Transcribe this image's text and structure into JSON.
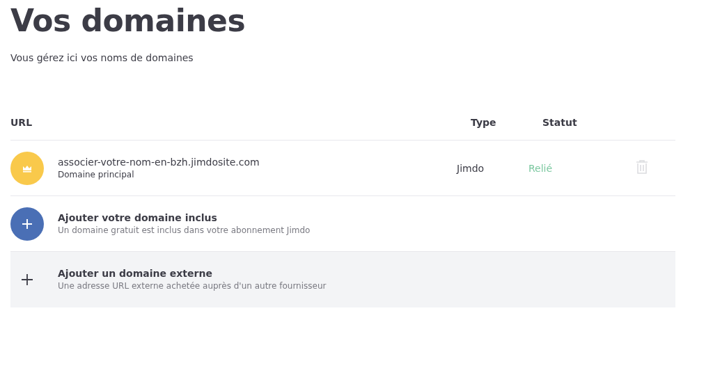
{
  "title": "Vos domaines",
  "subtitle": "Vous gérez ici vos noms de domaines",
  "table": {
    "columns": [
      "URL",
      "Type",
      "Statut"
    ],
    "rows": [
      {
        "kind": "domain",
        "name": "associer-votre-nom-en-bzh.jimdosite.com",
        "description": "Domaine principal",
        "type": "Jimdo",
        "status": "Relié"
      },
      {
        "kind": "add-included",
        "name": "Ajouter votre domaine inclus",
        "description": "Un domaine gratuit est inclus dans votre abonnement Jimdo"
      },
      {
        "kind": "add-external",
        "name": "Ajouter un domaine externe",
        "description": "Une adresse URL externe achetée auprès d'un autre fournisseur"
      }
    ]
  }
}
